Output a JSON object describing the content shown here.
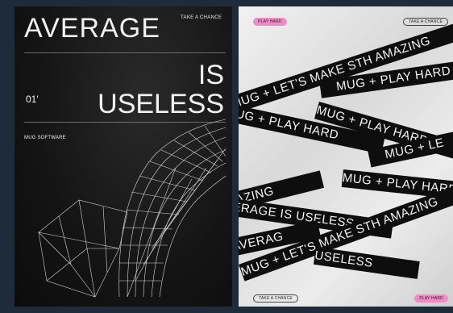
{
  "left_poster": {
    "title_line1": "AVERAGE",
    "tag": "TAKE A CHANCE",
    "title_line2": "IS",
    "number": "01'",
    "title_line3": "USELESS",
    "brand": "MUG SOFTWARE"
  },
  "right_poster": {
    "pill_top_left": "PLAY HARD",
    "pill_top_right": "TAKE A CHANCE",
    "pill_bottom_left": "TAKE A CHANCE",
    "pill_bottom_right": "PLAY HARD",
    "bands": [
      "MUG + LET'S MAKE STH AMAZING",
      "MUG + PLAY HARD",
      "MUG + PLAY HARD",
      "MUG + PLAY HARD",
      "MUG + LE",
      "MUG + PLAY HARD",
      "AZING",
      "ERAGE IS USELESS",
      "AVERAG",
      "MUG + LET'S MAKE STH AMAZING",
      "USELESS"
    ]
  },
  "colors": {
    "background": "#1d2b3a",
    "left_poster_bg": "#121212",
    "right_poster_bg": "#e6e6e6",
    "pink_accent": "#ef8bc6",
    "band": "#0e0e0e"
  }
}
